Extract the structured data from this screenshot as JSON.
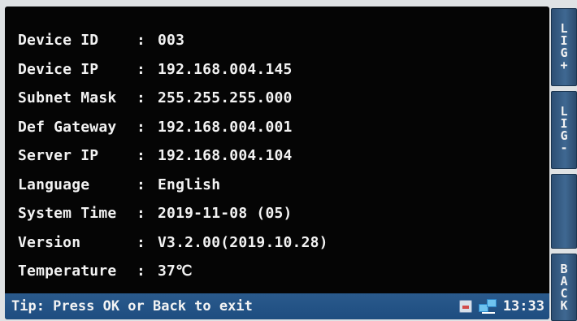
{
  "device_info": {
    "rows": [
      {
        "label": "Device ID",
        "sep": ":",
        "value": "003"
      },
      {
        "label": "Device IP",
        "sep": ":",
        "value": "192.168.004.145"
      },
      {
        "label": "Subnet Mask",
        "sep": ":",
        "value": "255.255.255.000"
      },
      {
        "label": "Def Gateway",
        "sep": ":",
        "value": "192.168.004.001"
      },
      {
        "label": "Server IP",
        "sep": ":",
        "value": "192.168.004.104"
      },
      {
        "label": "Language",
        "sep": ":",
        "value": "English"
      },
      {
        "label": "System Time",
        "sep": ":",
        "value": "2019-11-08 (05)"
      },
      {
        "label": "Version",
        "sep": ":",
        "value": "V3.2.00(2019.10.28)"
      },
      {
        "label": "Temperature",
        "sep": ":",
        "value": "37℃"
      }
    ]
  },
  "status_bar": {
    "tip": "Tip: Press OK or Back to exit",
    "time": "13:33",
    "icons": [
      "sd-card-icon",
      "network-icon"
    ]
  },
  "side_buttons": [
    {
      "name": "light-plus",
      "chars": [
        "L",
        "I",
        "G",
        "+"
      ]
    },
    {
      "name": "light-minus",
      "chars": [
        "L",
        "I",
        "G",
        "-"
      ]
    },
    {
      "name": "blank",
      "chars": []
    },
    {
      "name": "back",
      "chars": [
        "B",
        "A",
        "C",
        "K"
      ]
    }
  ],
  "colors": {
    "screen_background": "#050505",
    "status_bar": "#1e4d80",
    "side_button": "#3f6892"
  }
}
